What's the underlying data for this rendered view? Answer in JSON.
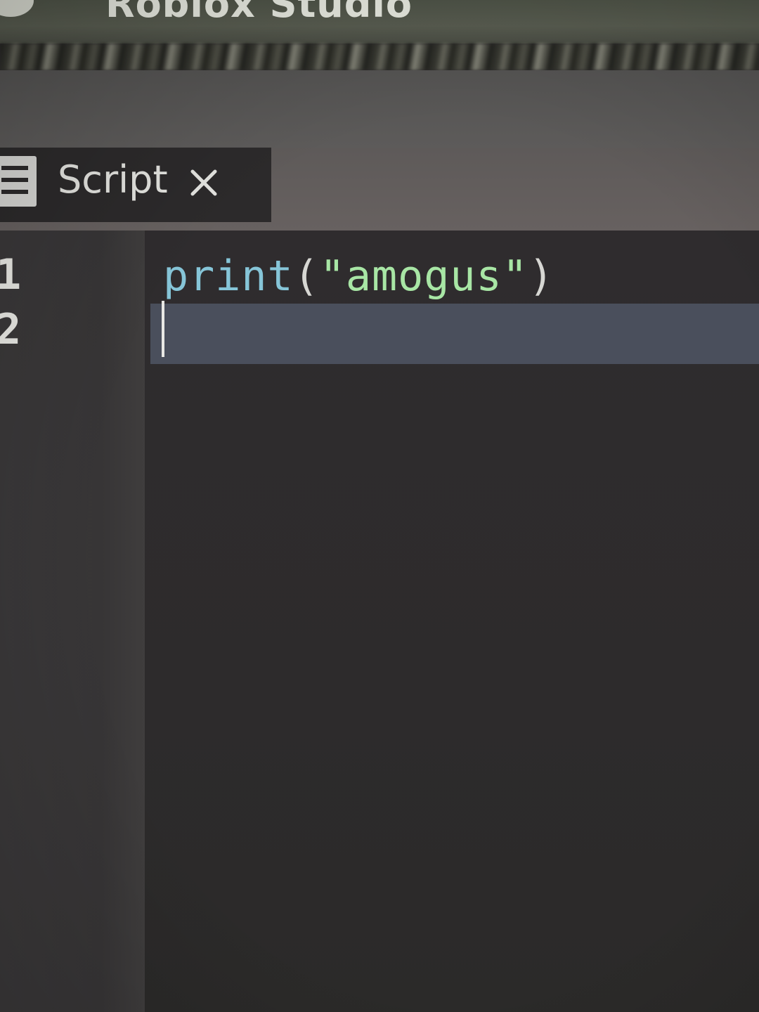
{
  "window": {
    "title": "Roblox Studio",
    "logo_icon": "roblox-studio-logo-icon"
  },
  "tabs": [
    {
      "label": "Script",
      "icon": "script-document-icon",
      "close_icon": "close-icon",
      "active": true
    }
  ],
  "editor": {
    "line_numbers": [
      "1",
      "2"
    ],
    "current_line": 2,
    "lines": [
      {
        "tokens": [
          {
            "text": "print",
            "kind": "builtin"
          },
          {
            "text": "(",
            "kind": "paren"
          },
          {
            "text": "\"amogus\"",
            "kind": "string"
          },
          {
            "text": ")",
            "kind": "paren"
          }
        ]
      },
      {
        "tokens": []
      }
    ]
  },
  "colors": {
    "editor_background": "#2f2c2e",
    "gutter_background": "#3a3839",
    "current_line_highlight": "#4a4f5c",
    "builtin_token": "#86c5d8",
    "string_token": "#a8e6a5",
    "punctuation_token": "#d7d7d3",
    "line_number": "#e9e9e4"
  }
}
